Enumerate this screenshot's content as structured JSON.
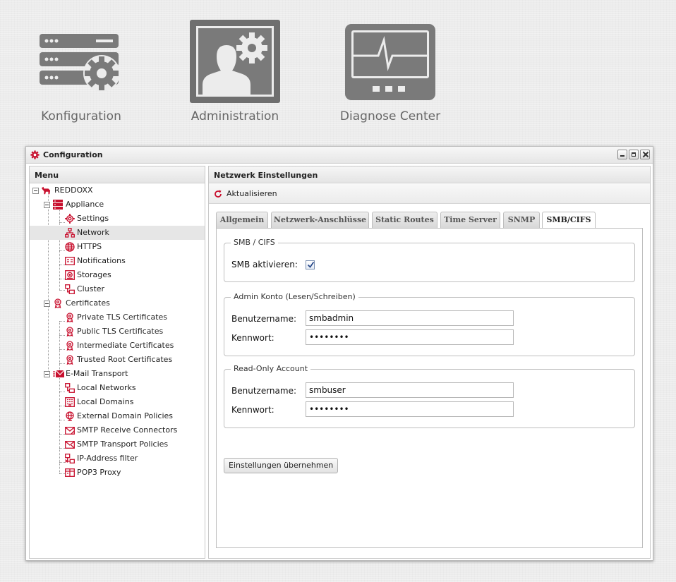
{
  "launcher": {
    "items": [
      {
        "label": "Konfiguration",
        "icon": "server-gear-icon"
      },
      {
        "label": "Administration",
        "icon": "user-gear-icon"
      },
      {
        "label": "Diagnose Center",
        "icon": "monitor-pulse-icon"
      }
    ]
  },
  "window": {
    "title": "Configuration",
    "icon": "gear-icon",
    "buttons": [
      "minimize",
      "maximize",
      "close"
    ]
  },
  "menu": {
    "header": "Menu",
    "root": "REDDOXX",
    "appliance": {
      "label": "Appliance",
      "items": [
        "Settings",
        "Network",
        "HTTPS",
        "Notifications",
        "Storages",
        "Cluster"
      ],
      "selected": "Network"
    },
    "certificates": {
      "label": "Certificates",
      "items": [
        "Private TLS Certificates",
        "Public TLS Certificates",
        "Intermediate Certificates",
        "Trusted Root Certificates"
      ]
    },
    "email": {
      "label": "E-Mail Transport",
      "items": [
        "Local Networks",
        "Local Domains",
        "External Domain Policies",
        "SMTP Receive Connectors",
        "SMTP Transport Policies",
        "IP-Address filter",
        "POP3 Proxy"
      ]
    }
  },
  "content": {
    "header": "Netzwerk Einstellungen",
    "refresh_label": "Aktualisieren",
    "tabs": [
      "Allgemein",
      "Netzwerk-Anschlüsse",
      "Static Routes",
      "Time Server",
      "SNMP",
      "SMB/CIFS"
    ],
    "active_tab": "SMB/CIFS",
    "smb": {
      "legend": "SMB / CIFS",
      "enable_label": "SMB aktivieren:",
      "enabled": true
    },
    "admin": {
      "legend": "Admin Konto (Lesen/Schreiben)",
      "user_label": "Benutzername:",
      "user_value": "smbadmin",
      "pass_label": "Kennwort:",
      "pass_value": "••••••••"
    },
    "readonly": {
      "legend": "Read-Only Account",
      "user_label": "Benutzername:",
      "user_value": "smbuser",
      "pass_label": "Kennwort:",
      "pass_value": "••••••••"
    },
    "apply_label": "Einstellungen übernehmen"
  },
  "colors": {
    "accent_red": "#c8102e",
    "launcher_gray": "#777777"
  }
}
